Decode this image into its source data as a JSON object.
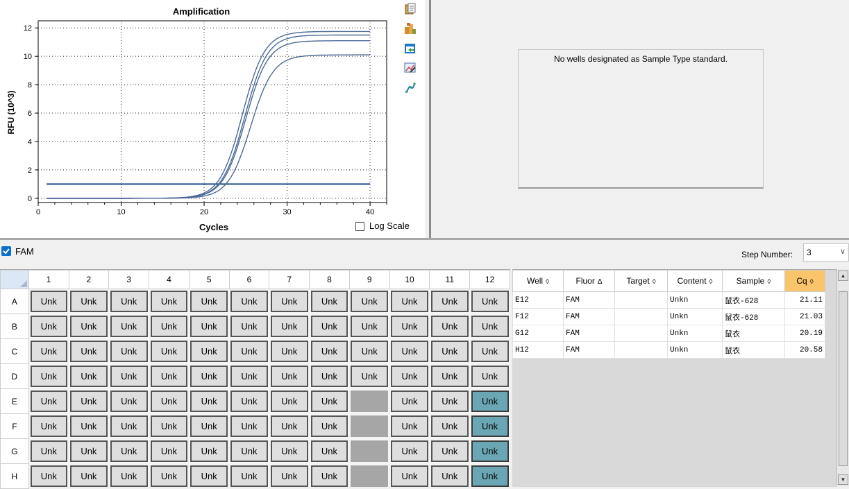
{
  "chart": {
    "title": "Amplification",
    "xlabel": "Cycles",
    "ylabel": "RFU (10^3)",
    "log_scale_label": "Log Scale",
    "log_scale_checked": false
  },
  "chart_data": {
    "type": "line",
    "title": "Amplification",
    "xlabel": "Cycles",
    "ylabel": "RFU (10^3)",
    "xlim": [
      0,
      42
    ],
    "ylim": [
      -0.3,
      12.5
    ],
    "xticks": [
      0,
      10,
      20,
      30,
      40
    ],
    "yticks": [
      0,
      2,
      4,
      6,
      8,
      10,
      12
    ],
    "grid": true,
    "threshold": 1.0,
    "curve_color": "#4a6a96",
    "threshold_color": "#1f4f8a",
    "series": [
      {
        "max": 11.75,
        "midpoint": 24.6
      },
      {
        "max": 11.5,
        "midpoint": 24.9
      },
      {
        "max": 11.1,
        "midpoint": 25.0
      },
      {
        "max": 10.1,
        "midpoint": 25.6
      }
    ]
  },
  "standard_panel": {
    "message": "No wells designated as Sample Type standard."
  },
  "fluor_filter": {
    "label": "FAM",
    "checked": true
  },
  "step": {
    "label": "Step Number:",
    "value": "3"
  },
  "plate": {
    "columns": [
      "1",
      "2",
      "3",
      "4",
      "5",
      "6",
      "7",
      "8",
      "9",
      "10",
      "11",
      "12"
    ],
    "rows": [
      "A",
      "B",
      "C",
      "D",
      "E",
      "F",
      "G",
      "H"
    ],
    "well_label": "Unk",
    "empty_wells": [
      "E9",
      "F9",
      "G9",
      "H9"
    ],
    "selected_wells": [
      "E12",
      "F12",
      "G12",
      "H12"
    ]
  },
  "well_list": {
    "columns": [
      {
        "label": "Well",
        "sort": "◊"
      },
      {
        "label": "Fluor",
        "sort": "Δ"
      },
      {
        "label": "Target",
        "sort": "◊"
      },
      {
        "label": "Content",
        "sort": "◊"
      },
      {
        "label": "Sample",
        "sort": "◊"
      },
      {
        "label": "Cq",
        "sort": "◊"
      }
    ],
    "rows": [
      {
        "well": "E12",
        "fluor": "FAM",
        "target": "",
        "content": "Unkn",
        "sample": "鼠衣-628",
        "cq": "21.11"
      },
      {
        "well": "F12",
        "fluor": "FAM",
        "target": "",
        "content": "Unkn",
        "sample": "鼠衣-628",
        "cq": "21.03"
      },
      {
        "well": "G12",
        "fluor": "FAM",
        "target": "",
        "content": "Unkn",
        "sample": "鼠衣",
        "cq": "20.19"
      },
      {
        "well": "H12",
        "fluor": "FAM",
        "target": "",
        "content": "Unkn",
        "sample": "鼠衣",
        "cq": "20.58"
      }
    ]
  },
  "toolbar_icons": [
    "copy-icon",
    "export-data-icon",
    "export-image-icon",
    "chart-settings-icon",
    "curve-fit-icon"
  ]
}
